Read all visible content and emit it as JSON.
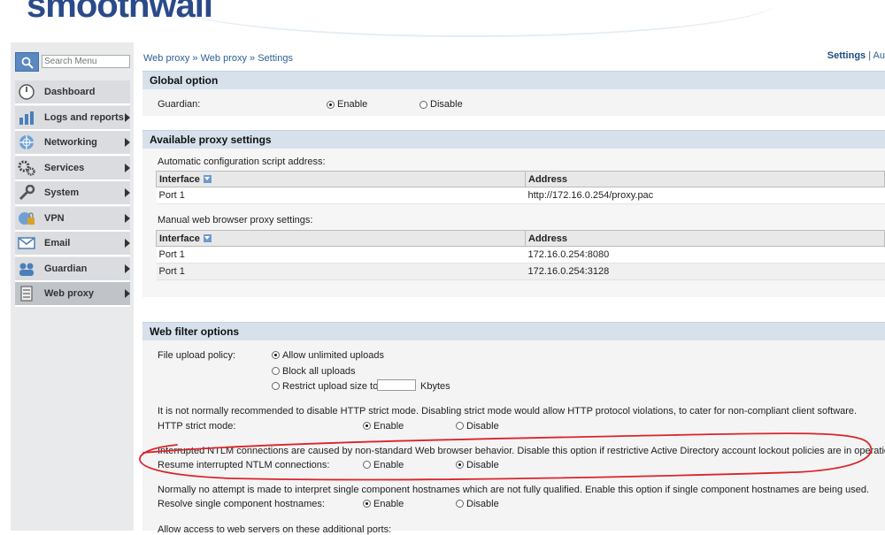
{
  "header": {
    "logo_text": "smoothwall"
  },
  "search": {
    "placeholder": "Search Menu"
  },
  "nav": {
    "items": [
      {
        "label": "Dashboard",
        "icon": "dashboard-icon",
        "arrow": false
      },
      {
        "label": "Logs and reports",
        "icon": "logs-icon",
        "arrow": true
      },
      {
        "label": "Networking",
        "icon": "network-icon",
        "arrow": true
      },
      {
        "label": "Services",
        "icon": "services-icon",
        "arrow": true
      },
      {
        "label": "System",
        "icon": "system-icon",
        "arrow": true
      },
      {
        "label": "VPN",
        "icon": "vpn-icon",
        "arrow": true
      },
      {
        "label": "Email",
        "icon": "email-icon",
        "arrow": true
      },
      {
        "label": "Guardian",
        "icon": "guardian-icon",
        "arrow": true
      },
      {
        "label": "Web proxy",
        "icon": "webproxy-icon",
        "arrow": true,
        "active": true
      }
    ]
  },
  "breadcrumb": {
    "text": "Web proxy » Web proxy » Settings"
  },
  "topright": {
    "active": "Settings",
    "rest": "| Au"
  },
  "global": {
    "title": "Global option",
    "guardian_label": "Guardian:",
    "enable": "Enable",
    "disable": "Disable",
    "selected": "enable"
  },
  "proxy": {
    "title": "Available proxy settings",
    "auto_label": "Automatic configuration script address:",
    "manual_label": "Manual web browser proxy settings:",
    "col_interface": "Interface",
    "col_address": "Address",
    "auto_rows": [
      {
        "iface": "Port 1",
        "addr": "http://172.16.0.254/proxy.pac"
      }
    ],
    "manual_rows": [
      {
        "iface": "Port 1",
        "addr": "172.16.0.254:8080"
      },
      {
        "iface": "Port 1",
        "addr": "172.16.0.254:3128"
      }
    ]
  },
  "filter": {
    "title": "Web filter options",
    "upload_label": "File upload policy:",
    "upload_opts": [
      "Allow unlimited uploads",
      "Block all uploads",
      "Restrict upload size to"
    ],
    "upload_selected": 0,
    "kbytes": "Kbytes",
    "strict_note": "It is not normally recommended to disable HTTP strict mode. Disabling strict mode would allow HTTP protocol violations, to cater for non-compliant client software.",
    "strict_label": "HTTP strict mode:",
    "strict_selected": "enable",
    "ntlm_note": "Interrupted NTLM connections are caused by non-standard Web browser behavior. Disable this option if restrictive Active Directory account lockout policies are in operation.",
    "ntlm_label": "Resume interrupted NTLM connections:",
    "ntlm_selected": "disable",
    "single_note": "Normally no attempt is made to interpret single component hostnames which are not fully qualified. Enable this option if single component hostnames are being used.",
    "single_label": "Resolve single component hostnames:",
    "single_selected": "enable",
    "ports_note": "Allow access to web servers on these additional ports:",
    "enable": "Enable",
    "disable": "Disable"
  },
  "colors": {
    "accent": "#2e5f93",
    "section_head": "#d6e1ec",
    "annotation": "#d9252a"
  }
}
